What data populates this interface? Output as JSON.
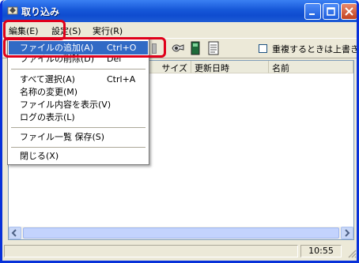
{
  "window": {
    "title": "取り込み"
  },
  "menubar": {
    "items": [
      {
        "label": "編集(E)"
      },
      {
        "label": "設定(S)"
      },
      {
        "label": "実行(R)"
      }
    ]
  },
  "toolbar": {
    "overwrite_checkbox_label": "重複するときは上書き"
  },
  "dropdown": {
    "items": [
      {
        "label": "ファイルの追加(A)",
        "shortcut": "Ctrl+O"
      },
      {
        "label": "ファイルの削除(D)",
        "shortcut": "Del"
      },
      {
        "label": "すべて選択(A)",
        "shortcut": "Ctrl+A"
      },
      {
        "label": "名称の変更(M)",
        "shortcut": ""
      },
      {
        "label": "ファイル内容を表示(V)",
        "shortcut": ""
      },
      {
        "label": "ログの表示(L)",
        "shortcut": ""
      },
      {
        "label": "ファイル一覧 保存(S)",
        "shortcut": ""
      },
      {
        "label": "閉じる(X)",
        "shortcut": ""
      }
    ]
  },
  "listview": {
    "columns": [
      {
        "label": "サイズ"
      },
      {
        "label": "更新日時"
      },
      {
        "label": "名前"
      }
    ]
  },
  "status": {
    "time": "10:55"
  },
  "colors": {
    "titlebar": "#1657d8",
    "highlight": "#316ac5",
    "annotation": "#e0001b",
    "window_bg": "#ece9d8"
  },
  "icons": [
    "app-icon",
    "minimize-icon",
    "maximize-icon",
    "close-icon",
    "tool-icon",
    "battery-icon",
    "document-icon"
  ]
}
